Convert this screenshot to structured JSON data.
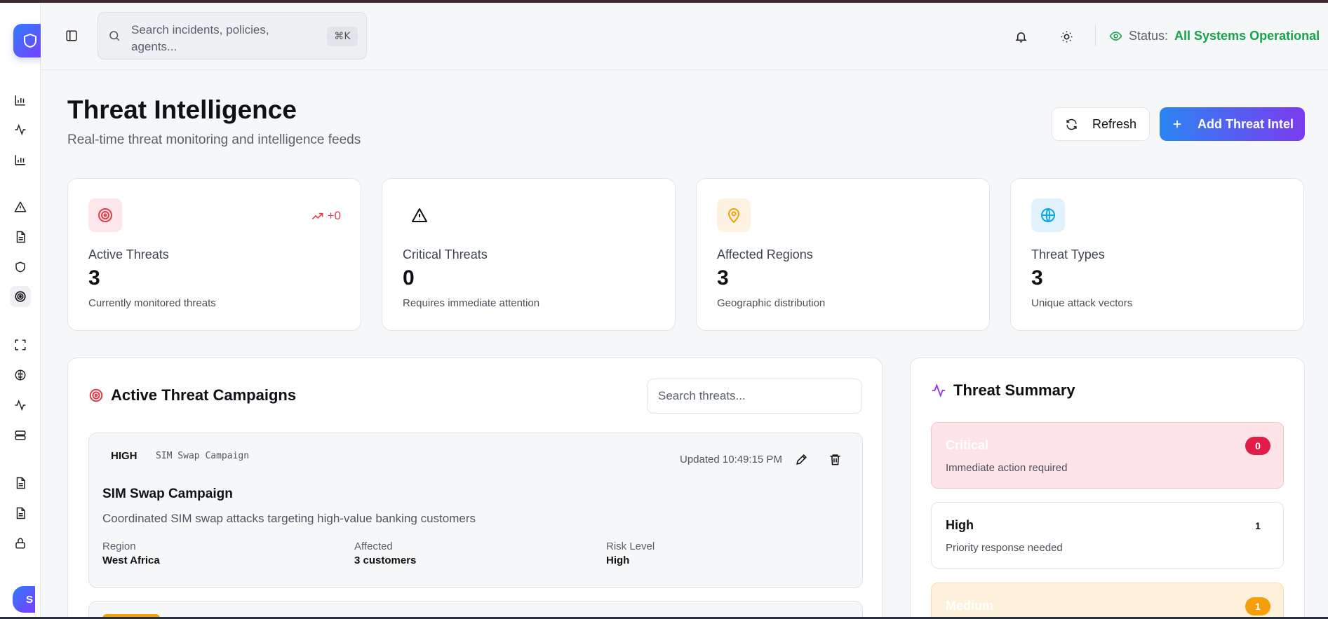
{
  "header": {
    "search_placeholder": "Search incidents, policies, agents...",
    "search_shortcut": "⌘K",
    "status_label": "Status:",
    "status_value": "All Systems Operational",
    "status_color": "#16a34a"
  },
  "sidebar": {
    "items": [
      {
        "icon": "bar-chart-icon"
      },
      {
        "icon": "activity-icon"
      },
      {
        "icon": "bar-chart-icon"
      },
      {
        "icon": "alert-triangle-icon"
      },
      {
        "icon": "file-text-icon"
      },
      {
        "icon": "shield-icon"
      },
      {
        "icon": "target-icon",
        "active": true
      },
      {
        "icon": "scan-icon"
      },
      {
        "icon": "brain-icon"
      },
      {
        "icon": "activity-icon"
      },
      {
        "icon": "server-icon"
      },
      {
        "icon": "file-text-icon"
      },
      {
        "icon": "file-text-icon"
      },
      {
        "icon": "lock-icon"
      }
    ],
    "avatar_initial": "S"
  },
  "page": {
    "title": "Threat Intelligence",
    "subtitle": "Real-time threat monitoring and intelligence feeds",
    "refresh_label": "Refresh",
    "add_label": "Add Threat Intel"
  },
  "stats": [
    {
      "label": "Active Threats",
      "value": "3",
      "desc": "Currently monitored threats",
      "trend": "+0",
      "icon": "target-icon",
      "color": "#e23b4a"
    },
    {
      "label": "Critical Threats",
      "value": "0",
      "desc": "Requires immediate attention",
      "icon": "alert-triangle-icon",
      "color": "#111111"
    },
    {
      "label": "Affected Regions",
      "value": "3",
      "desc": "Geographic distribution",
      "icon": "map-pin-icon",
      "color": "#f59e0b"
    },
    {
      "label": "Threat Types",
      "value": "3",
      "desc": "Unique attack vectors",
      "icon": "globe-icon",
      "color": "#0ea5e9"
    }
  ],
  "campaigns": {
    "title": "Active Threat Campaigns",
    "search_placeholder": "Search threats...",
    "items": [
      {
        "severity": "HIGH",
        "tag": "SIM Swap Campaign",
        "updated": "Updated 10:49:15 PM",
        "name": "SIM Swap Campaign",
        "description": "Coordinated SIM swap attacks targeting high-value banking customers",
        "region_label": "Region",
        "region": "West Africa",
        "affected_label": "Affected",
        "affected": "3 customers",
        "risk_label": "Risk Level",
        "risk": "High"
      }
    ]
  },
  "summary": {
    "title": "Threat Summary",
    "levels": [
      {
        "name": "Critical",
        "desc": "Immediate action required",
        "count": "0",
        "color": "#e11d48"
      },
      {
        "name": "High",
        "desc": "Priority response needed",
        "count": "1"
      },
      {
        "name": "Medium",
        "count": "1",
        "color": "#f59e0b"
      }
    ]
  }
}
